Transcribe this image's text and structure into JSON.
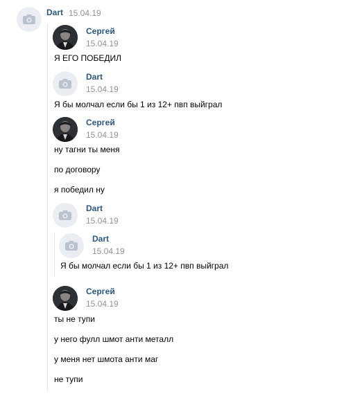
{
  "header": {
    "sender": "Dart",
    "date": "15.04.19",
    "avatar_icon": "camera-icon"
  },
  "entries": [
    {
      "sender": "Сергей",
      "date": "15.04.19",
      "avatar": "user-photo",
      "messages": [
        "Я ЕГО ПОБЕДИЛ"
      ]
    },
    {
      "sender": "Dart",
      "date": "15.04.19",
      "avatar": "camera-icon",
      "messages": [
        "Я бы молчал если бы 1 из 12+ пвп выйграл"
      ]
    },
    {
      "sender": "Сергей",
      "date": "15.04.19",
      "avatar": "user-photo",
      "messages": [
        "ну тагни ты меня",
        "по договору",
        "я победил ну"
      ]
    },
    {
      "sender": "Dart",
      "date": "15.04.19",
      "avatar": "camera-icon",
      "messages": []
    },
    {
      "sender": "Dart",
      "date": "15.04.19",
      "avatar": "camera-icon",
      "messages": [
        "Я бы молчал если бы 1 из 12+ пвп выйграл"
      ]
    },
    {
      "sender": "Сергей",
      "date": "15.04.19",
      "avatar": "user-photo",
      "messages": [
        "ты не тупи",
        "у него фулл шмот анти металл",
        "у меня нет шмота анти маг",
        "не тупи"
      ]
    }
  ],
  "colors": {
    "name": "#2a5885",
    "date": "#939393",
    "rule": "#dfe4ea",
    "avatar_bg": "#eaedf1",
    "camera": "#b9c2cd"
  }
}
